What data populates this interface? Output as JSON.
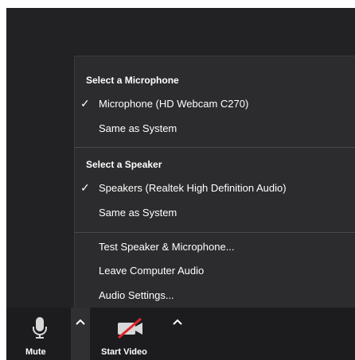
{
  "audio_menu": {
    "microphone_section": {
      "title": "Select a Microphone",
      "options": [
        {
          "label": "Microphone (HD Webcam C270)",
          "checked": true
        },
        {
          "label": "Same as System",
          "checked": false
        }
      ]
    },
    "speaker_section": {
      "title": "Select a Speaker",
      "options": [
        {
          "label": "Speakers (Realtek High Definition Audio)",
          "checked": true
        },
        {
          "label": "Same as System",
          "checked": false
        }
      ]
    },
    "actions": [
      {
        "label": "Test Speaker & Microphone..."
      },
      {
        "label": "Leave Computer Audio"
      },
      {
        "label": "Audio Settings..."
      }
    ],
    "check_glyph": "✓"
  },
  "toolbar": {
    "mute_label": "Mute",
    "start_video_label": "Start Video",
    "mute_icon": "microphone-icon",
    "video_icon": "video-camera-off-icon"
  },
  "colors": {
    "background": "#222224",
    "menu_background": "#2c2c2e",
    "toolbar_background": "#1c1c1e",
    "text": "#ffffff",
    "video_off_slash": "#e0262d"
  }
}
